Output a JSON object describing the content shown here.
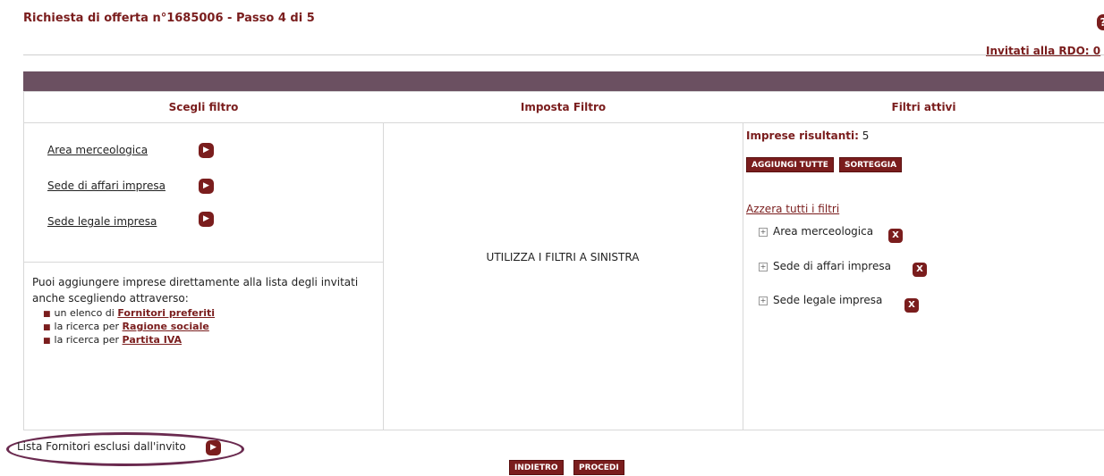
{
  "header": {
    "title": "Richiesta di offerta n°1685006 - Passo 4 di 5",
    "help_icon": "?",
    "invited_link": "Invitati alla RDO: 0"
  },
  "columns": {
    "choose": "Scegli filtro",
    "set": "Imposta Filtro",
    "active": "Filtri attivi"
  },
  "filters": [
    {
      "label": "Area merceologica",
      "icon": "arrow-right-icon"
    },
    {
      "label": "Sede di affari impresa",
      "icon": "arrow-right-icon"
    },
    {
      "label": "Sede legale impresa",
      "icon": "arrow-right-icon"
    }
  ],
  "info": {
    "text": "Puoi aggiungere imprese direttamente alla lista degli invitati anche scegliendo attraverso:",
    "items": [
      {
        "prefix": "un elenco di ",
        "link": "Fornitori preferiti"
      },
      {
        "prefix": "la ricerca per ",
        "link": "Ragione sociale"
      },
      {
        "prefix": "la ricerca per ",
        "link": "Partita IVA"
      }
    ]
  },
  "center": {
    "message": "UTILIZZA I FILTRI A SINISTRA"
  },
  "active": {
    "results_label": "Imprese risultanti:",
    "results_count": "5",
    "add_all": "AGGIUNGI TUTTE",
    "draw": "SORTEGGIA",
    "reset": "Azzera tutti i filtri",
    "items": [
      {
        "label": "Area merceologica"
      },
      {
        "label": "Sede di affari impresa"
      },
      {
        "label": "Sede legale impresa"
      }
    ],
    "remove_icon": "X"
  },
  "footer": {
    "excluded": "Lista Fornitori esclusi dall'invito",
    "back": "INDIETRO",
    "proceed": "PROCEDI"
  },
  "colors": {
    "accent": "#7a1d1d",
    "header_bar": "#6b5061",
    "highlight_ellipse": "#6a2a4f"
  }
}
